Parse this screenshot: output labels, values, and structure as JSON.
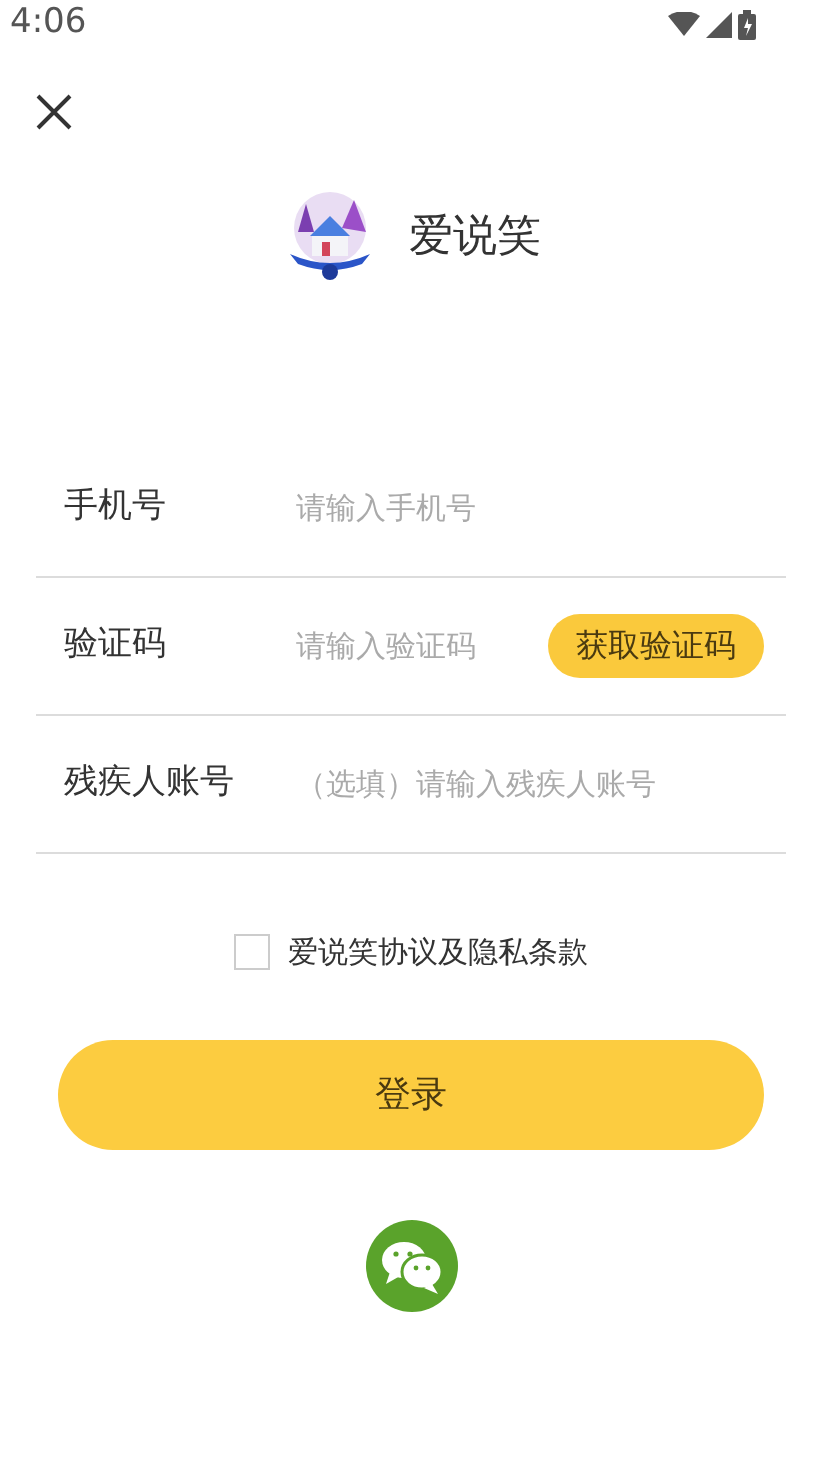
{
  "status_bar": {
    "time": "4:06"
  },
  "app": {
    "name": "爱说笑"
  },
  "fields": [
    {
      "label": "手机号",
      "placeholder": "请输入手机号"
    },
    {
      "label": "验证码",
      "placeholder": "请输入验证码",
      "button": "获取验证码"
    },
    {
      "label": "残疾人账号",
      "placeholder": "（选填）请输入残疾人账号"
    }
  ],
  "agreement": {
    "label": "爱说笑协议及隐私条款",
    "checked": false
  },
  "login_button": "登录"
}
